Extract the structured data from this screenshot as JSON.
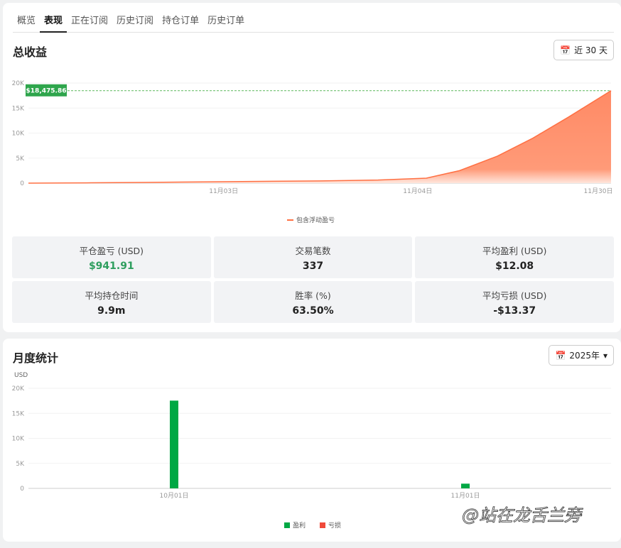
{
  "tabs": [
    "概览",
    "表现",
    "正在订阅",
    "历史订阅",
    "持仓订单",
    "历史订单"
  ],
  "active_tab": 1,
  "total": {
    "title": "总收益",
    "range_button": "近 30 天",
    "chart_data": {
      "type": "area",
      "series": [
        {
          "name": "包含浮动盈亏",
          "color": "#ff8a65",
          "points": [
            [
              0,
              0
            ],
            [
              0.1,
              60
            ],
            [
              0.2,
              150
            ],
            [
              0.3,
              250
            ],
            [
              0.4,
              350
            ],
            [
              0.5,
              450
            ],
            [
              0.6,
              620
            ],
            [
              0.683,
              1000
            ],
            [
              0.74,
              2500
            ],
            [
              0.805,
              5400
            ],
            [
              0.866,
              9000
            ],
            [
              0.927,
              13200
            ],
            [
              1,
              18475.86
            ]
          ]
        }
      ],
      "yticks": [
        "0",
        "5K",
        "10K",
        "15K",
        "20K"
      ],
      "ylim": [
        0,
        20000
      ],
      "xticks": [
        {
          "label": "11月03日",
          "t": 0.335
        },
        {
          "label": "11月04日",
          "t": 0.668
        },
        {
          "label": "11月30日",
          "t": 1
        }
      ],
      "marker_label": "$18,475.86",
      "marker_value": 18475.86,
      "legend": "包含浮动盈亏"
    }
  },
  "stats": [
    {
      "label": "平仓盈亏 (USD)",
      "value": "$941.91",
      "color": "#2e9e5e"
    },
    {
      "label": "交易笔数",
      "value": "337"
    },
    {
      "label": "平均盈利 (USD)",
      "value": "$12.08"
    },
    {
      "label": "平均持仓时间",
      "value": "9.9m"
    },
    {
      "label": "胜率 (%)",
      "value": "63.50%"
    },
    {
      "label": "平均亏损 (USD)",
      "value": "-$13.37"
    }
  ],
  "monthly": {
    "title": "月度统计",
    "year_button": "2025年",
    "chart_data": {
      "type": "bar",
      "unit": "USD",
      "categories": [
        "10月01日",
        "11月01日"
      ],
      "cat_t": [
        0.25,
        0.75
      ],
      "series": [
        {
          "name": "盈利",
          "color": "#00a844",
          "values": [
            17533,
            942
          ]
        },
        {
          "name": "亏损",
          "color": "#f04a3a",
          "values": [
            0,
            0
          ]
        }
      ],
      "yticks": [
        "0",
        "5K",
        "10K",
        "15K",
        "20K"
      ],
      "ylim": [
        0,
        20000
      ]
    }
  },
  "watermark": "@站在龙舌兰旁"
}
